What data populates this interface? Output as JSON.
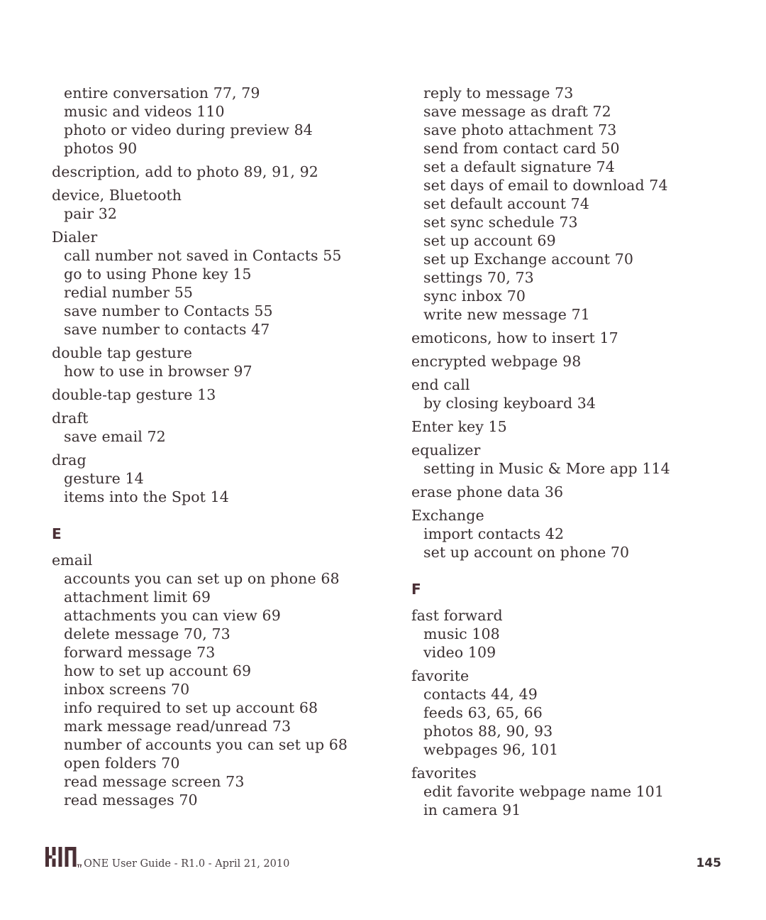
{
  "document": {
    "page_number": "145",
    "footer_text": "ONE User Guide - R1.0 - April 21, 2010",
    "logo_label": "KIN",
    "logo_trademark": "TM",
    "text_color": "#3a3032",
    "heading_color": "#4a2f35"
  },
  "columns": [
    {
      "name": "left-column",
      "groups": [
        {
          "entries": [
            {
              "indent": "sub",
              "text": "entire conversation  77, 79"
            },
            {
              "indent": "sub",
              "text": "music and videos  110"
            },
            {
              "indent": "sub",
              "text": "photo or video during preview  84"
            },
            {
              "indent": "sub",
              "text": "photos  90"
            }
          ]
        },
        {
          "entries": [
            {
              "indent": "main",
              "text": "description, add to photo  89,  91,  92"
            }
          ]
        },
        {
          "entries": [
            {
              "indent": "main",
              "text": "device, Bluetooth"
            },
            {
              "indent": "sub",
              "text": "pair  32"
            }
          ]
        },
        {
          "entries": [
            {
              "indent": "main",
              "text": "Dialer"
            },
            {
              "indent": "sub",
              "text": "call number not saved in Contacts  55"
            },
            {
              "indent": "sub",
              "text": "go to using Phone key  15"
            },
            {
              "indent": "sub",
              "text": "redial number  55"
            },
            {
              "indent": "sub",
              "text": "save number to Contacts  55"
            },
            {
              "indent": "sub",
              "text": "save number to contacts  47"
            }
          ]
        },
        {
          "entries": [
            {
              "indent": "main",
              "text": "double tap gesture"
            },
            {
              "indent": "sub",
              "text": "how to use in browser  97"
            }
          ]
        },
        {
          "entries": [
            {
              "indent": "main",
              "text": "double-tap gesture  13"
            }
          ]
        },
        {
          "entries": [
            {
              "indent": "main",
              "text": "draft"
            },
            {
              "indent": "sub",
              "text": "save email  72"
            }
          ]
        },
        {
          "entries": [
            {
              "indent": "main",
              "text": "drag"
            },
            {
              "indent": "sub",
              "text": "gesture  14"
            },
            {
              "indent": "sub",
              "text": "items into the Spot  14"
            }
          ]
        }
      ],
      "letter_heading": "E",
      "groups_after_heading": [
        {
          "entries": [
            {
              "indent": "main",
              "text": "email"
            },
            {
              "indent": "sub",
              "text": "accounts you can set up on phone  68"
            },
            {
              "indent": "sub",
              "text": "attachment limit  69"
            },
            {
              "indent": "sub",
              "text": "attachments you can view  69"
            },
            {
              "indent": "sub",
              "text": "delete message  70, 73"
            },
            {
              "indent": "sub",
              "text": "forward message  73"
            },
            {
              "indent": "sub",
              "text": "how to set up account  69"
            },
            {
              "indent": "sub",
              "text": "inbox screens  70"
            },
            {
              "indent": "sub",
              "text": "info required to set up account  68"
            },
            {
              "indent": "sub",
              "text": "mark message read/unread 73"
            },
            {
              "indent": "sub",
              "text": "number of accounts you can set up  68"
            },
            {
              "indent": "sub",
              "text": "open folders  70"
            },
            {
              "indent": "sub",
              "text": "read message screen  73"
            },
            {
              "indent": "sub",
              "text": "read messages  70"
            }
          ]
        }
      ]
    },
    {
      "name": "right-column",
      "groups": [
        {
          "entries": [
            {
              "indent": "sub",
              "text": "reply to message  73"
            },
            {
              "indent": "sub",
              "text": "save message as draft  72"
            },
            {
              "indent": "sub",
              "text": "save photo attachment  73"
            },
            {
              "indent": "sub",
              "text": "send from contact card  50"
            },
            {
              "indent": "sub",
              "text": "set a default signature  74"
            },
            {
              "indent": "sub",
              "text": "set days of email to download  74"
            },
            {
              "indent": "sub",
              "text": "set default account  74"
            },
            {
              "indent": "sub",
              "text": "set sync schedule  73"
            },
            {
              "indent": "sub",
              "text": "set up account  69"
            },
            {
              "indent": "sub",
              "text": "set up Exchange account  70"
            },
            {
              "indent": "sub",
              "text": "settings  70, 73"
            },
            {
              "indent": "sub",
              "text": "sync inbox  70"
            },
            {
              "indent": "sub",
              "text": "write new message  71"
            }
          ]
        },
        {
          "entries": [
            {
              "indent": "main",
              "text": "emoticons, how to insert  17"
            }
          ]
        },
        {
          "entries": [
            {
              "indent": "main",
              "text": "encrypted webpage  98"
            }
          ]
        },
        {
          "entries": [
            {
              "indent": "main",
              "text": "end call"
            },
            {
              "indent": "sub",
              "text": "by closing keyboard  34"
            }
          ]
        },
        {
          "entries": [
            {
              "indent": "main",
              "text": "Enter key  15"
            }
          ]
        },
        {
          "entries": [
            {
              "indent": "main",
              "text": "equalizer"
            },
            {
              "indent": "sub",
              "text": "setting in Music & More app  114"
            }
          ]
        },
        {
          "entries": [
            {
              "indent": "main",
              "text": "erase phone data  36"
            }
          ]
        },
        {
          "entries": [
            {
              "indent": "main",
              "text": "Exchange"
            },
            {
              "indent": "sub",
              "text": "import contacts  42"
            },
            {
              "indent": "sub",
              "text": "set up account on phone  70"
            }
          ]
        }
      ],
      "letter_heading": "F",
      "groups_after_heading": [
        {
          "entries": [
            {
              "indent": "main",
              "text": "fast forward"
            },
            {
              "indent": "sub",
              "text": "music  108"
            },
            {
              "indent": "sub",
              "text": "video  109"
            }
          ]
        },
        {
          "entries": [
            {
              "indent": "main",
              "text": "favorite"
            },
            {
              "indent": "sub",
              "text": "contacts  44, 49"
            },
            {
              "indent": "sub",
              "text": "feeds  63, 65, 66"
            },
            {
              "indent": "sub",
              "text": "photos  88, 90, 93"
            },
            {
              "indent": "sub",
              "text": "webpages  96, 101"
            }
          ]
        },
        {
          "entries": [
            {
              "indent": "main",
              "text": "favorites"
            },
            {
              "indent": "sub",
              "text": "edit favorite webpage name  101"
            },
            {
              "indent": "sub",
              "text": "in camera  91"
            }
          ]
        }
      ]
    }
  ]
}
